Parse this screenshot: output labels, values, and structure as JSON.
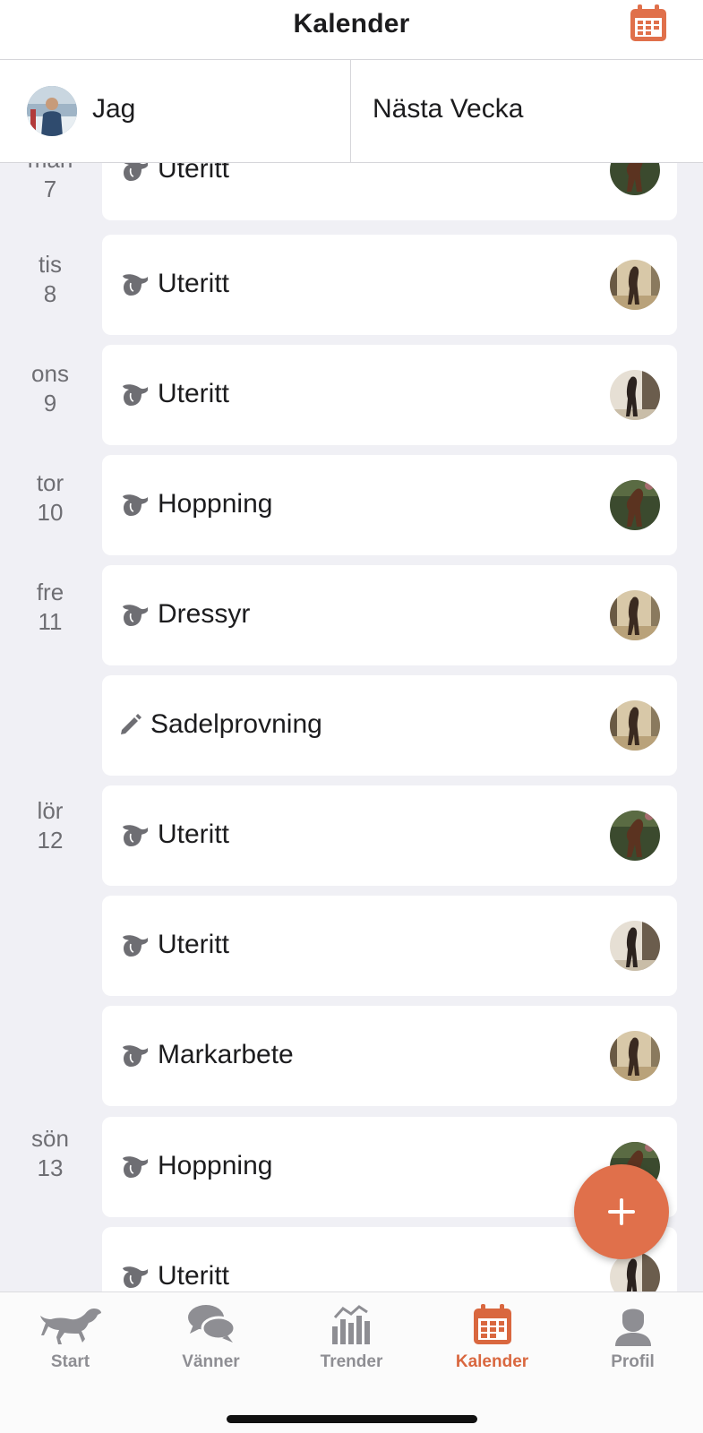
{
  "header": {
    "title": "Kalender"
  },
  "segments": {
    "me_label": "Jag",
    "next_label": "Nästa Vecka"
  },
  "list": {
    "days": [
      {
        "name": "mån",
        "num": "7"
      },
      {
        "name": "tis",
        "num": "8"
      },
      {
        "name": "ons",
        "num": "9"
      },
      {
        "name": "tor",
        "num": "10"
      },
      {
        "name": "fre",
        "num": "11"
      },
      {
        "name": "lör",
        "num": "12"
      },
      {
        "name": "sön",
        "num": "13"
      }
    ],
    "items": [
      {
        "label": "Uteritt",
        "icon": "saddle-icon"
      },
      {
        "label": "Uteritt",
        "icon": "saddle-icon"
      },
      {
        "label": "Uteritt",
        "icon": "saddle-icon"
      },
      {
        "label": "Hoppning",
        "icon": "saddle-icon"
      },
      {
        "label": "Dressyr",
        "icon": "saddle-icon"
      },
      {
        "label": "Sadelprovning",
        "icon": "pencil-icon"
      },
      {
        "label": "Uteritt",
        "icon": "saddle-icon"
      },
      {
        "label": "Uteritt",
        "icon": "saddle-icon"
      },
      {
        "label": "Markarbete",
        "icon": "saddle-icon"
      },
      {
        "label": "Hoppning",
        "icon": "saddle-icon"
      },
      {
        "label": "Uteritt",
        "icon": "saddle-icon"
      }
    ]
  },
  "fab": {
    "icon": "plus-icon"
  },
  "tabs": [
    {
      "label": "Start",
      "icon": "horse-icon"
    },
    {
      "label": "Vänner",
      "icon": "chat-bubbles-icon"
    },
    {
      "label": "Trender",
      "icon": "bar-chart-icon"
    },
    {
      "label": "Kalender",
      "icon": "calendar-icon"
    },
    {
      "label": "Profil",
      "icon": "person-icon"
    }
  ],
  "colors": {
    "accent": "#e0704b",
    "active_tab": "#d9673f",
    "inactive_tab": "#8e8e93",
    "background": "#f0f0f5"
  }
}
